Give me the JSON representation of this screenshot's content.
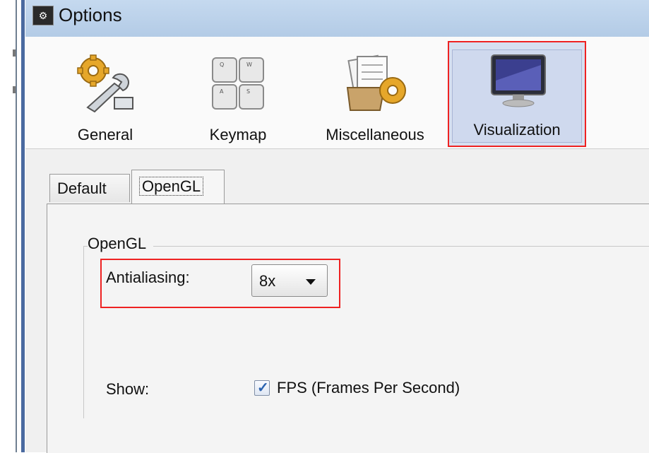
{
  "window": {
    "title": "Options"
  },
  "toolbar": {
    "items": [
      {
        "label": "General",
        "icon": "gear-wrench-icon",
        "selected": false
      },
      {
        "label": "Keymap",
        "icon": "keyboard-keys-icon",
        "selected": false
      },
      {
        "label": "Miscellaneous",
        "icon": "folder-gear-icon",
        "selected": false
      },
      {
        "label": "Visualization",
        "icon": "monitor-icon",
        "selected": true
      }
    ]
  },
  "tabs": [
    {
      "label": "Default",
      "active": false
    },
    {
      "label": "OpenGL",
      "active": true
    }
  ],
  "opengl": {
    "group_title": "OpenGL",
    "antialiasing": {
      "label": "Antialiasing:",
      "value": "8x"
    },
    "show": {
      "label": "Show:",
      "fps": {
        "label": "FPS (Frames Per Second)",
        "checked": true
      }
    }
  },
  "colors": {
    "highlight_border": "#e22222",
    "selection_bg": "#d6dff0"
  }
}
